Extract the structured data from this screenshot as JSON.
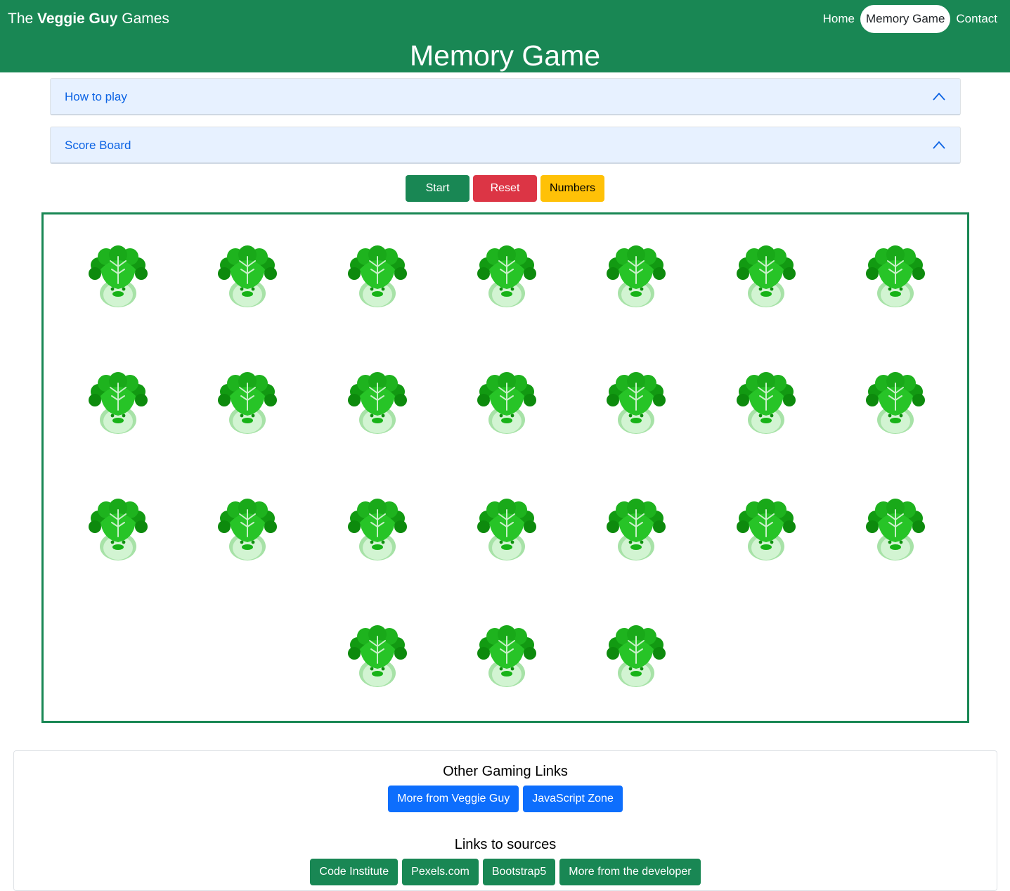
{
  "header": {
    "brand_prefix": "The",
    "brand_bold": "Veggie Guy",
    "brand_suffix": "Games",
    "nav": [
      {
        "label": "Home",
        "active": false
      },
      {
        "label": "Memory Game",
        "active": true
      },
      {
        "label": "Contact",
        "active": false
      }
    ],
    "page_title": "Memory Game",
    "bar_color": "#198754"
  },
  "accordions": [
    {
      "label": "How to play",
      "icon": "chevron-up-icon"
    },
    {
      "label": "Score Board",
      "icon": "chevron-up-icon"
    }
  ],
  "controls": {
    "start_label": "Start",
    "reset_label": "Reset",
    "numbers_label": "Numbers",
    "start_color": "#198754",
    "reset_color": "#dc3545",
    "numbers_color": "#ffc107"
  },
  "board": {
    "rows": [
      7,
      7,
      7,
      3
    ],
    "card_face": "bok-choy-veggie-icon",
    "border_color": "#198754"
  },
  "footer": {
    "gaming_heading": "Other Gaming Links",
    "gaming_links": [
      "More from Veggie Guy",
      "JavaScript Zone"
    ],
    "sources_heading": "Links to sources",
    "source_links": [
      "Code Institute",
      "Pexels.com",
      "Bootstrap5",
      "More from the developer"
    ]
  }
}
